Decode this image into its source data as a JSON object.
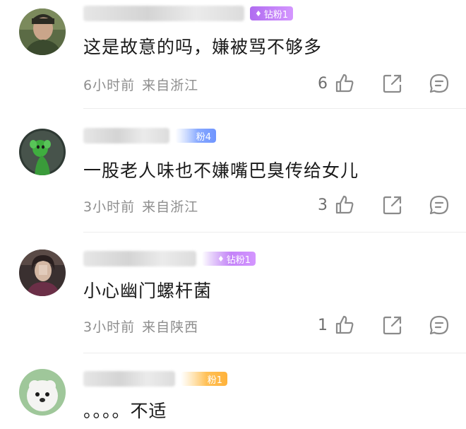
{
  "comments": [
    {
      "badge": "钻粉1",
      "badge_style": "purple",
      "text": "这是故意的吗，嫌被骂不够多",
      "time": "6小时前",
      "location": "来自浙江",
      "likes": "6"
    },
    {
      "badge": "粉4",
      "badge_style": "blue",
      "text": "一股老人味也不嫌嘴巴臭传给女儿",
      "time": "3小时前",
      "location": "来自浙江",
      "likes": "3"
    },
    {
      "badge": "钻粉1",
      "badge_style": "purple",
      "text": "小心幽门螺杆菌",
      "time": "3小时前",
      "location": "来自陕西",
      "likes": "1"
    },
    {
      "badge": "粉1",
      "badge_style": "orange",
      "text": "。。。。不适",
      "time": "",
      "location": "",
      "likes": ""
    }
  ],
  "icons": {
    "like": "thumbs-up-icon",
    "share": "share-icon",
    "reply": "comment-bubble-icon",
    "diamond": "diamond-icon"
  },
  "colors": {
    "badge_purple": "#b06cf0",
    "badge_blue": "#6f95ff",
    "badge_orange": "#ffb23a",
    "meta_gray": "#8e8e8e"
  }
}
